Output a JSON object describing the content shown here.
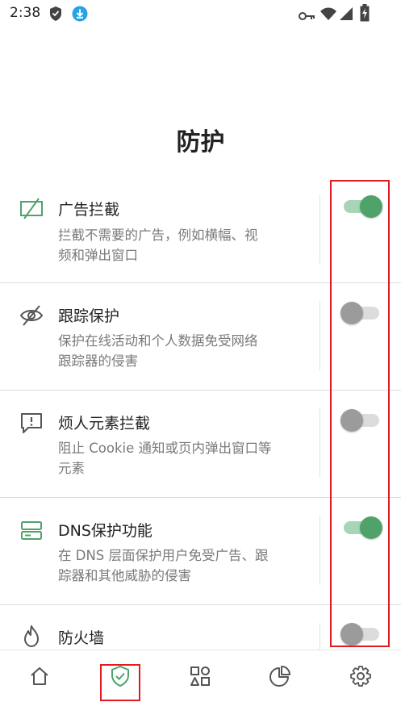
{
  "status_bar": {
    "time": "2:38",
    "left_icons": [
      "shield-status-icon",
      "download-status-icon"
    ],
    "right_icons": [
      "vpn-key-icon",
      "wifi-icon",
      "signal-icon",
      "battery-charging-icon"
    ]
  },
  "page": {
    "title": "防护"
  },
  "rows": [
    {
      "icon": "ad-block-icon",
      "title": "广告拦截",
      "desc_line1": "拦截不需要的广告，例如横幅、视",
      "desc_line2": "频和弹出窗口",
      "enabled": true
    },
    {
      "icon": "eye-off-icon",
      "title": "跟踪保护",
      "desc_line1": "保护在线活动和个人数据免受网络",
      "desc_line2": "跟踪器的侵害",
      "enabled": false
    },
    {
      "icon": "alert-message-icon",
      "title": "烦人元素拦截",
      "desc_line1": "阻止 Cookie 通知或页内弹出窗口等",
      "desc_line2": "元素",
      "enabled": false
    },
    {
      "icon": "dns-server-icon",
      "title": "DNS保护功能",
      "desc_line1": "在 DNS 层面保护用户免受广告、跟",
      "desc_line2": "踪器和其他威胁的侵害",
      "enabled": true
    },
    {
      "icon": "fire-icon",
      "title": "防火墙",
      "enabled": false
    }
  ],
  "bottom_nav": {
    "items": [
      "home-icon",
      "shield-check-icon",
      "apps-grid-icon",
      "pie-chart-icon",
      "settings-gear-icon"
    ],
    "active": "shield-check-icon"
  },
  "colors": {
    "accent_green": "#4fa36a",
    "toggle_on_track": "#a8d5b5",
    "toggle_off_knob": "#9b9b9b",
    "highlight_red": "#e21b23"
  }
}
